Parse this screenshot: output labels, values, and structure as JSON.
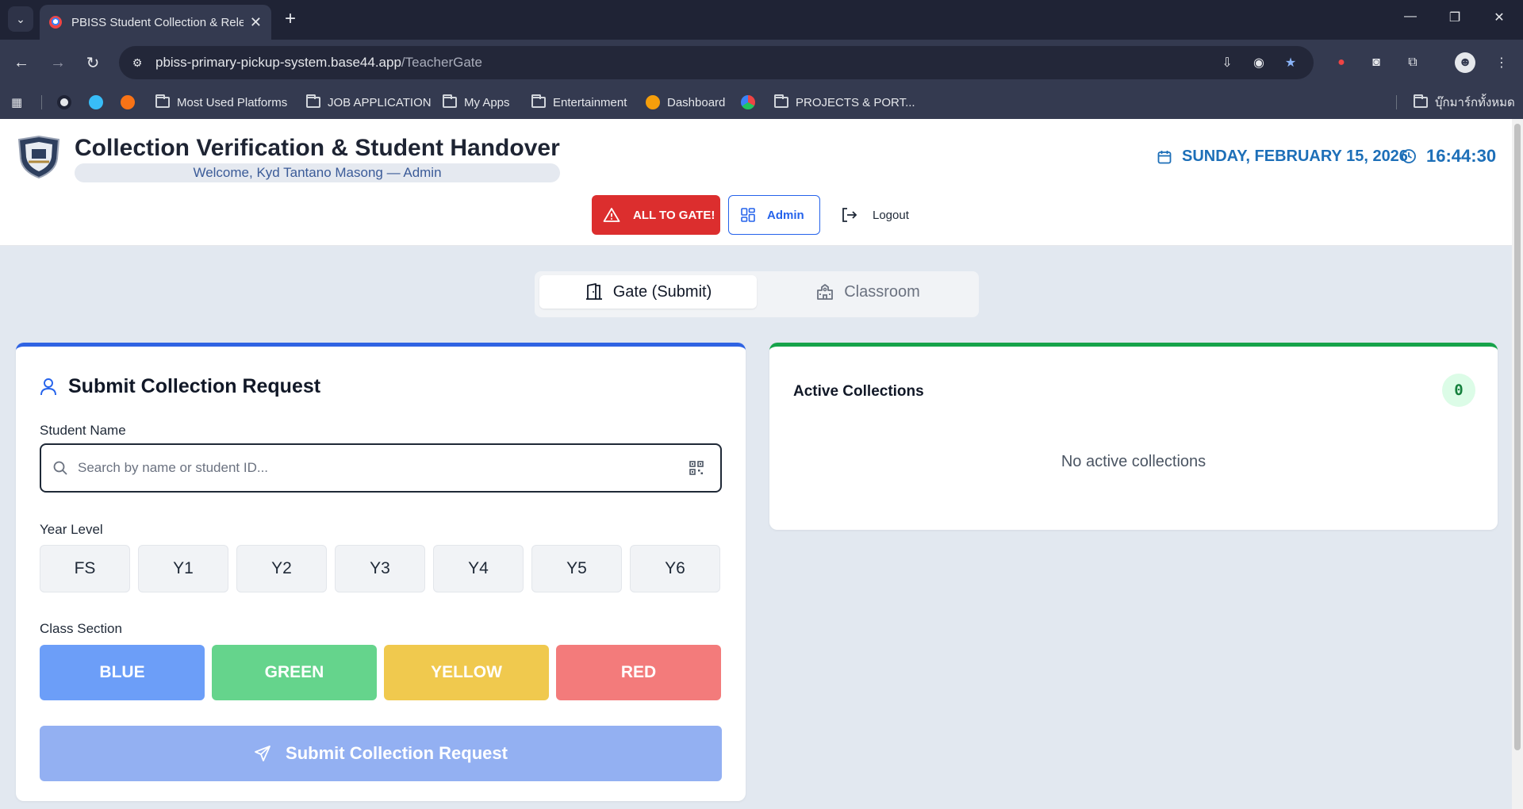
{
  "browser": {
    "tab_title": "PBISS Student Collection & Release",
    "url_domain": "pbiss-primary-pickup-system.base44.app",
    "url_path": "/TeacherGate",
    "bookmarks": [
      {
        "label": "Most Used Platforms",
        "icon": "folder-icon"
      },
      {
        "label": "JOB APPLICATION",
        "icon": "folder-icon"
      },
      {
        "label": "My Apps",
        "icon": "folder-icon"
      },
      {
        "label": "Entertainment",
        "icon": "folder-icon"
      },
      {
        "label": "Dashboard",
        "icon": "dashboard-favicon"
      },
      {
        "label": "PROJECTS & PORT...",
        "icon": "folder-icon"
      }
    ],
    "other_bookmarks": "บุ๊กมาร์กทั้งหมด"
  },
  "header": {
    "title": "Collection Verification & Student Handover",
    "welcome": "Welcome, Kyd Tantano Masong — Admin",
    "date": "SUNDAY, FEBRUARY 15, 2026",
    "time": "16:44:30",
    "alert_button": "ALL TO GATE!",
    "admin_button": "Admin",
    "logout_button": "Logout"
  },
  "tabs": [
    {
      "label": "Gate (Submit)",
      "icon": "gate-icon",
      "active": true
    },
    {
      "label": "Classroom",
      "icon": "school-icon",
      "active": false
    }
  ],
  "submit_form": {
    "title": "Submit Collection Request",
    "student_label": "Student Name",
    "search_placeholder": "Search by name or student ID...",
    "year_label": "Year Level",
    "years": [
      "FS",
      "Y1",
      "Y2",
      "Y3",
      "Y4",
      "Y5",
      "Y6"
    ],
    "class_label": "Class Section",
    "classes": [
      {
        "label": "BLUE",
        "color": "#6c9ef8"
      },
      {
        "label": "GREEN",
        "color": "#65d48c"
      },
      {
        "label": "YELLOW",
        "color": "#f0c94e"
      },
      {
        "label": "RED",
        "color": "#f37b7b"
      }
    ],
    "submit_button": "Submit Collection Request"
  },
  "active_collections": {
    "title": "Active Collections",
    "count": "0",
    "empty_message": "No active collections"
  },
  "colors": {
    "primary": "#2f63e3",
    "alert": "#dc2e2e",
    "success": "#16a34a",
    "date_text": "#1d6fb8"
  }
}
